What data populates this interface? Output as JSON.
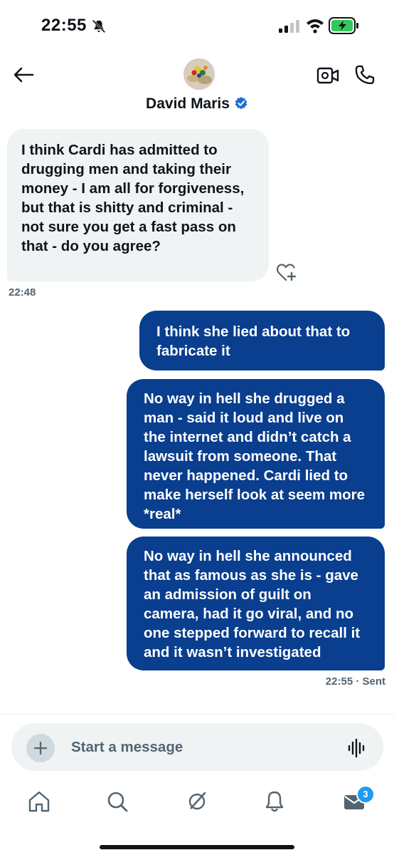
{
  "status_bar": {
    "time": "22:55",
    "battery_charging": true
  },
  "conversation": {
    "contact_name": "David Maris",
    "verified": true
  },
  "messages": [
    {
      "direction": "incoming",
      "text": "I think Cardi has admitted to drugging men and taking their money - I am all for forgiveness, but that is shitty and criminal - not sure you get a fast pass on that - do you agree?",
      "timestamp": "22:48"
    },
    {
      "direction": "outgoing",
      "text": "I think she lied about that to fabricate it"
    },
    {
      "direction": "outgoing",
      "text": "No way in hell she drugged a man - said it loud and live on the internet and didn’t catch a lawsuit from someone. That never happened. Cardi lied to make herself look at seem more *real*"
    },
    {
      "direction": "outgoing",
      "text": "No way in hell she announced that as famous as she is - gave an admission of guilt on camera, had it go viral, and no one stepped forward to recall it and it wasn’t investigated",
      "timestamp": "22:55 · Sent"
    }
  ],
  "composer": {
    "placeholder": "Start a message"
  },
  "tabs": {
    "messages_badge": "3"
  },
  "colors": {
    "outgoing_bubble": "#0a3e8e",
    "incoming_bubble": "#eff3f4",
    "accent": "#1d9bf0",
    "muted_text": "#536471"
  }
}
